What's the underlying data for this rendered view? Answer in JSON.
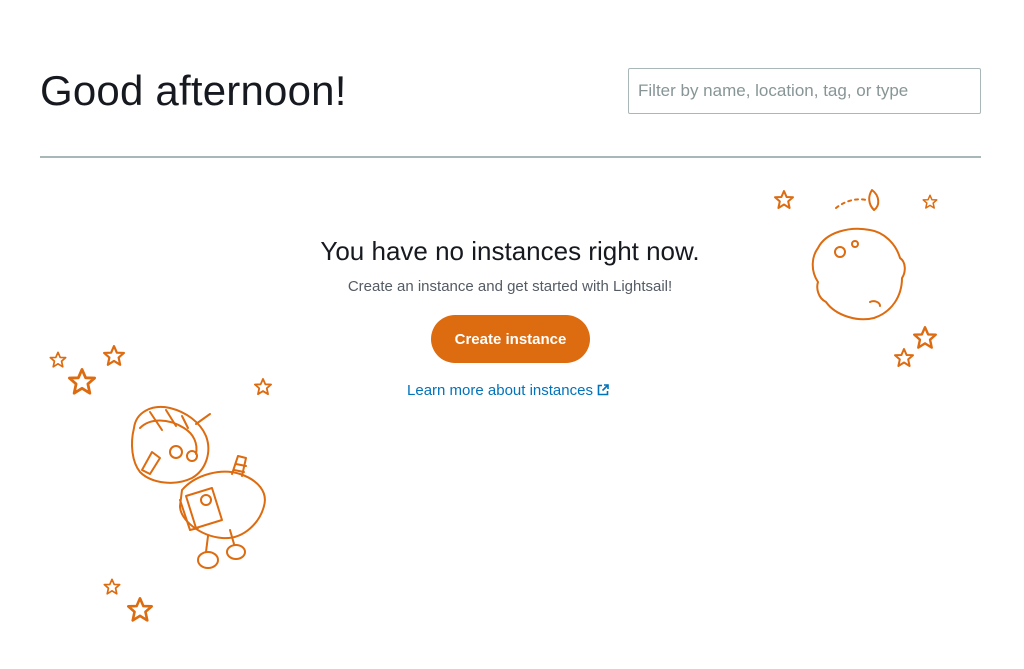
{
  "header": {
    "greeting": "Good afternoon!",
    "filter_placeholder": "Filter by name, location, tag, or type",
    "filter_value": ""
  },
  "empty_state": {
    "title": "You have no instances right now.",
    "subtitle": "Create an instance and get started with Lightsail!",
    "create_button_label": "Create instance",
    "learn_more_label": "Learn more about instances",
    "learn_more_icon": "external-link-icon"
  },
  "colors": {
    "accent": "#dd6b10",
    "link": "#0073bb",
    "text": "#16191f",
    "muted": "#545b64",
    "border": "#aab7b8"
  }
}
